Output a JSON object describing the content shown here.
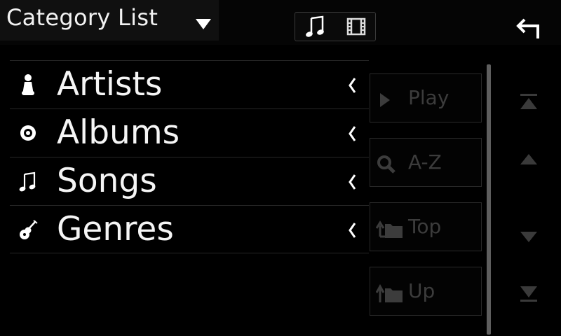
{
  "header": {
    "title": "Category List",
    "dropdown_icon": "triangle-down-icon",
    "mode_switch": [
      {
        "name": "music",
        "icon": "music-note-icon",
        "active": true
      },
      {
        "name": "video",
        "icon": "film-icon",
        "active": false
      }
    ],
    "back_icon": "back-arrow-icon"
  },
  "categories": [
    {
      "label": "Artists",
      "icon": "artist-icon"
    },
    {
      "label": "Albums",
      "icon": "album-icon"
    },
    {
      "label": "Songs",
      "icon": "music-note-icon"
    },
    {
      "label": "Genres",
      "icon": "guitar-icon"
    }
  ],
  "side_buttons": [
    {
      "label": "Play",
      "icon": "play-icon"
    },
    {
      "label": "A-Z",
      "icon": "search-icon"
    },
    {
      "label": "Top",
      "icon": "folder-top-icon"
    },
    {
      "label": "Up",
      "icon": "folder-up-icon"
    }
  ],
  "colors": {
    "background": "#000000",
    "text": "#f5f5f5",
    "disabled": "#3c3c3c"
  }
}
